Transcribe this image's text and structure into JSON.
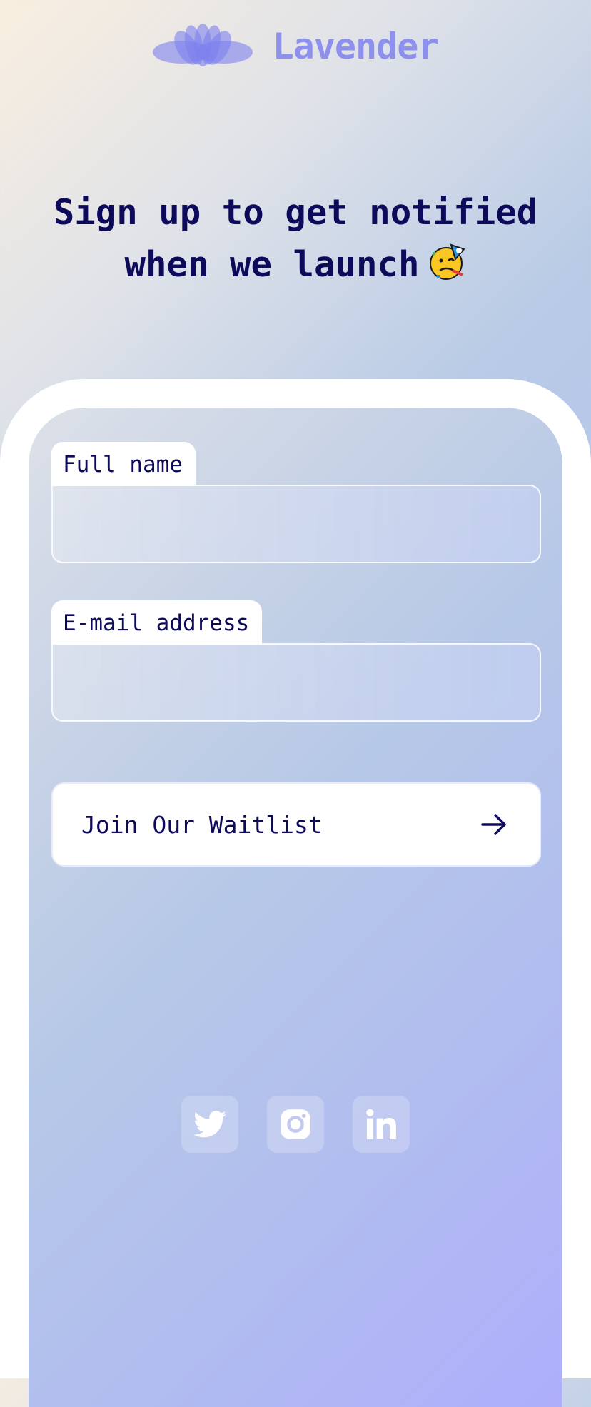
{
  "brand": {
    "name": "Lavender",
    "logo_icon": "lotus-icon",
    "color": "#8e90ee"
  },
  "headline": {
    "line1": "Sign up to get notified",
    "line2": "when we launch",
    "emoji_icon": "partying-face-icon"
  },
  "form": {
    "full_name": {
      "label": "Full name",
      "value": "",
      "placeholder": ""
    },
    "email": {
      "label": "E-mail address",
      "value": "",
      "placeholder": ""
    },
    "submit": {
      "label": "Join Our Waitlist",
      "icon": "arrow-right-icon"
    }
  },
  "socials": [
    {
      "icon": "twitter-icon"
    },
    {
      "icon": "instagram-icon"
    },
    {
      "icon": "linkedin-icon"
    }
  ],
  "colors": {
    "text_dark": "#0e0a5a",
    "accent": "#8e90ee",
    "card": "#ffffff"
  }
}
